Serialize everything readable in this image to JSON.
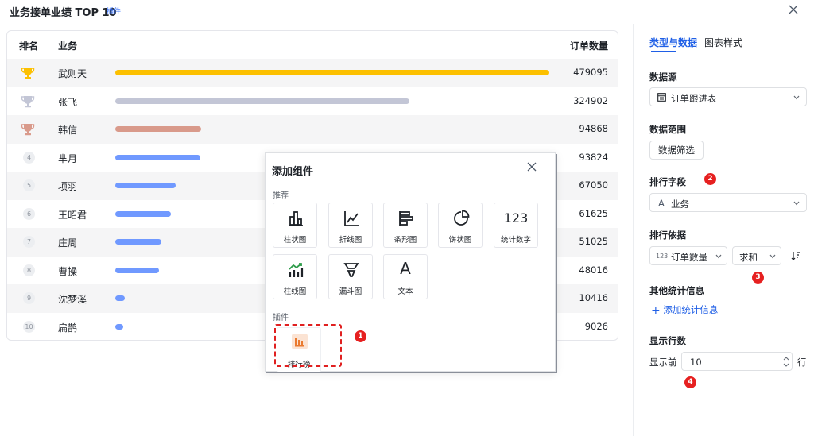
{
  "header": {
    "title": "业务接单业绩 TOP 10",
    "badge": "插件"
  },
  "table": {
    "columns": [
      "排名",
      "业务",
      "订单数量"
    ],
    "rows": [
      {
        "rank": "1",
        "name": "武则天",
        "value": "479095",
        "ratio": 1.0
      },
      {
        "rank": "2",
        "name": "张飞",
        "value": "324902",
        "ratio": 0.678
      },
      {
        "rank": "3",
        "name": "韩信",
        "value": "94868",
        "ratio": 0.198
      },
      {
        "rank": "4",
        "name": "芈月",
        "value": "93824",
        "ratio": 0.196
      },
      {
        "rank": "5",
        "name": "项羽",
        "value": "67050",
        "ratio": 0.14
      },
      {
        "rank": "6",
        "name": "王昭君",
        "value": "61625",
        "ratio": 0.129
      },
      {
        "rank": "7",
        "name": "庄周",
        "value": "51025",
        "ratio": 0.107
      },
      {
        "rank": "8",
        "name": "曹操",
        "value": "48016",
        "ratio": 0.1
      },
      {
        "rank": "9",
        "name": "沈梦溪",
        "value": "10416",
        "ratio": 0.022
      },
      {
        "rank": "10",
        "name": "扁鹊",
        "value": "9026",
        "ratio": 0.019
      }
    ]
  },
  "colors": {
    "gold": "#fcc000",
    "silver": "#c3c6d6",
    "bronze": "#d99a8b",
    "blue": "#7099ff",
    "accent": "#1f5fe6",
    "marker": "#e62020"
  },
  "dialog": {
    "title": "添加组件",
    "recommended_label": "推荐",
    "plugins_label": "插件",
    "recommended": [
      "柱状图",
      "折线图",
      "条形图",
      "饼状图",
      "统计数字",
      "柱线图",
      "漏斗图",
      "文本"
    ],
    "number_glyph": "123",
    "text_glyph": "A",
    "plugins": [
      "排行榜"
    ]
  },
  "panel": {
    "tabs": [
      "类型与数据",
      "图表样式"
    ],
    "datasource": {
      "label": "数据源",
      "value": "订单跟进表"
    },
    "range": {
      "label": "数据范围",
      "button": "数据筛选"
    },
    "rank_field": {
      "label": "排行字段",
      "value": "业务",
      "type_glyph": "A"
    },
    "rank_basis": {
      "label": "排行依据",
      "field": "订单数量",
      "field_glyph": "123",
      "agg": "求和"
    },
    "other_stats": {
      "label": "其他统计信息",
      "add": "添加统计信息"
    },
    "rows_shown": {
      "label": "显示行数",
      "prefix": "显示前",
      "value": "10",
      "suffix": "行"
    }
  },
  "markers": [
    "1",
    "2",
    "3",
    "4"
  ]
}
